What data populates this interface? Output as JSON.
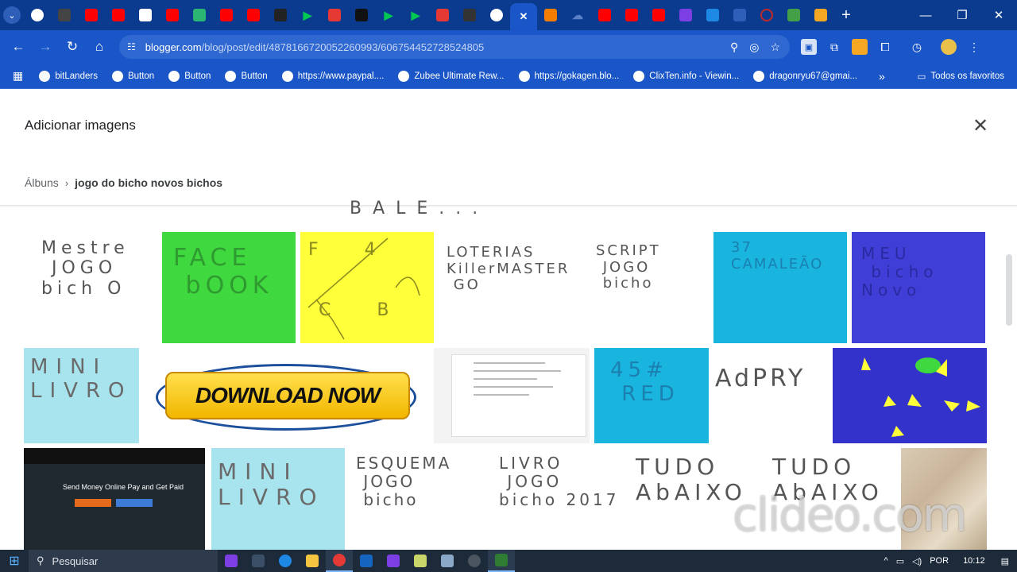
{
  "browser": {
    "tabs": [
      {
        "icon": "chrome-icon",
        "color": "#ffffff"
      },
      {
        "icon": "app-icon",
        "color": "#444444"
      },
      {
        "icon": "youtube-icon",
        "color": "#ff0000"
      },
      {
        "icon": "youtube-icon",
        "color": "#ff0000"
      },
      {
        "icon": "video-icon",
        "color": "#ffffff"
      },
      {
        "icon": "youtube-icon",
        "color": "#ff0000"
      },
      {
        "icon": "app-icon",
        "color": "#2bb673"
      },
      {
        "icon": "youtube-icon",
        "color": "#ff0000"
      },
      {
        "icon": "youtube-icon",
        "color": "#ff0000"
      },
      {
        "icon": "app-icon",
        "color": "#222222"
      },
      {
        "icon": "play-icon",
        "color": "#00c853"
      },
      {
        "icon": "app-icon",
        "color": "#e53935"
      },
      {
        "icon": "tiktok-icon",
        "color": "#111111"
      },
      {
        "icon": "play-icon",
        "color": "#00c853"
      },
      {
        "icon": "play-icon",
        "color": "#00c853"
      },
      {
        "icon": "app-icon",
        "color": "#e53935"
      },
      {
        "icon": "app-icon",
        "color": "#333333"
      },
      {
        "icon": "chrome-icon",
        "color": "#ffffff"
      },
      {
        "icon": "close-icon",
        "color": "#ffffff",
        "active": true
      },
      {
        "icon": "blogger-icon",
        "color": "#f57d00"
      },
      {
        "icon": "cloud-icon",
        "color": "#5b7fc7"
      },
      {
        "icon": "youtube-icon",
        "color": "#ff0000"
      },
      {
        "icon": "youtube-icon",
        "color": "#ff0000"
      },
      {
        "icon": "youtube-icon",
        "color": "#ff0000"
      },
      {
        "icon": "app-icon",
        "color": "#7b3fe4"
      },
      {
        "icon": "app-icon",
        "color": "#1e88e5"
      },
      {
        "icon": "app-icon",
        "color": "#2d5fb8"
      },
      {
        "icon": "circle-icon",
        "color": "#c62828"
      },
      {
        "icon": "app-icon",
        "color": "#43a047"
      },
      {
        "icon": "app-icon",
        "color": "#f5a623"
      }
    ],
    "url_host": "blogger.com",
    "url_path": "/blog/post/edit/4878166720052260993/6067544527285248​05",
    "bookmarks": [
      "bitLanders",
      "Button",
      "Button",
      "Button",
      "https://www.paypal....",
      "Zubee Ultimate Rew...",
      "https://gokagen.blo...",
      "ClixTen.info - Viewin...",
      "dragonryu67@gmai..."
    ],
    "bookmarks_all": "Todos os favoritos"
  },
  "dialog": {
    "title": "Adicionar imagens",
    "breadcrumb_root": "Álbuns",
    "breadcrumb_current": "jogo do bicho novos bichos"
  },
  "images": {
    "partial_top": "BALE...",
    "row1": [
      {
        "text": "Mestre\n JOGO\nbich O",
        "bg": "#ffffff",
        "ink": "#555555"
      },
      {
        "text": "FACE\n bOOK",
        "bg": "#3fd93f",
        "ink": "#2f9a2f"
      },
      {
        "text": "F    4\n\n\n C    B",
        "bg": "#ffff3a",
        "ink": "#8a8a20"
      },
      {
        "text": "LOTERIAS\nKillerMASTER\n GO",
        "bg": "#ffffff",
        "ink": "#555555"
      },
      {
        "text": "SCRIPT\n JOGO\n bicho",
        "bg": "#ffffff",
        "ink": "#555555"
      },
      {
        "text": "37\nCAMALEÃO",
        "bg": "#19b5df",
        "ink": "#1b7fb0"
      },
      {
        "text": "MEU\n bicho\nNovo",
        "bg": "#3f3fd8",
        "ink": "#2a2aa0"
      }
    ],
    "row2": [
      {
        "text": "MINI\nLIVRO",
        "bg": "#a8e4ee",
        "ink": "#6a6a6a"
      },
      {
        "text": "DOWNLOAD NOW",
        "bg": "#ffffff",
        "ink": "#111111"
      },
      {
        "text": "",
        "bg": "#f3f3f3",
        "ink": "#999999"
      },
      {
        "text": "45#\n RED",
        "bg": "#19b5df",
        "ink": "#1b7fb0"
      },
      {
        "text": "AdPRY",
        "bg": "#ffffff",
        "ink": "#555555"
      },
      {
        "text": "",
        "bg": "#3333cc",
        "ink": "#2a2aa0"
      }
    ],
    "row3": [
      {
        "text": "Send Money Online Pay and Get Paid",
        "bg": "#20292f",
        "ink": "#ffffff"
      },
      {
        "text": "MINI\nLIVRO",
        "bg": "#a8e4ee",
        "ink": "#6a6a6a"
      },
      {
        "text": "ESQUEMA\n JOGO\n bicho",
        "bg": "#ffffff",
        "ink": "#555555"
      },
      {
        "text": "LIVRO\n JOGO\nbicho 2017",
        "bg": "#ffffff",
        "ink": "#555555"
      },
      {
        "text": "TUDO\nAbAIXO",
        "bg": "#ffffff",
        "ink": "#555555"
      },
      {
        "text": "TUDO\nAbAIXO",
        "bg": "#ffffff",
        "ink": "#555555"
      },
      {
        "text": "",
        "bg": "#d9cbb4",
        "ink": "#555555"
      }
    ]
  },
  "taskbar": {
    "search_placeholder": "Pesquisar",
    "lang": "POR",
    "time": "10:12"
  },
  "watermark": "clideo.com"
}
